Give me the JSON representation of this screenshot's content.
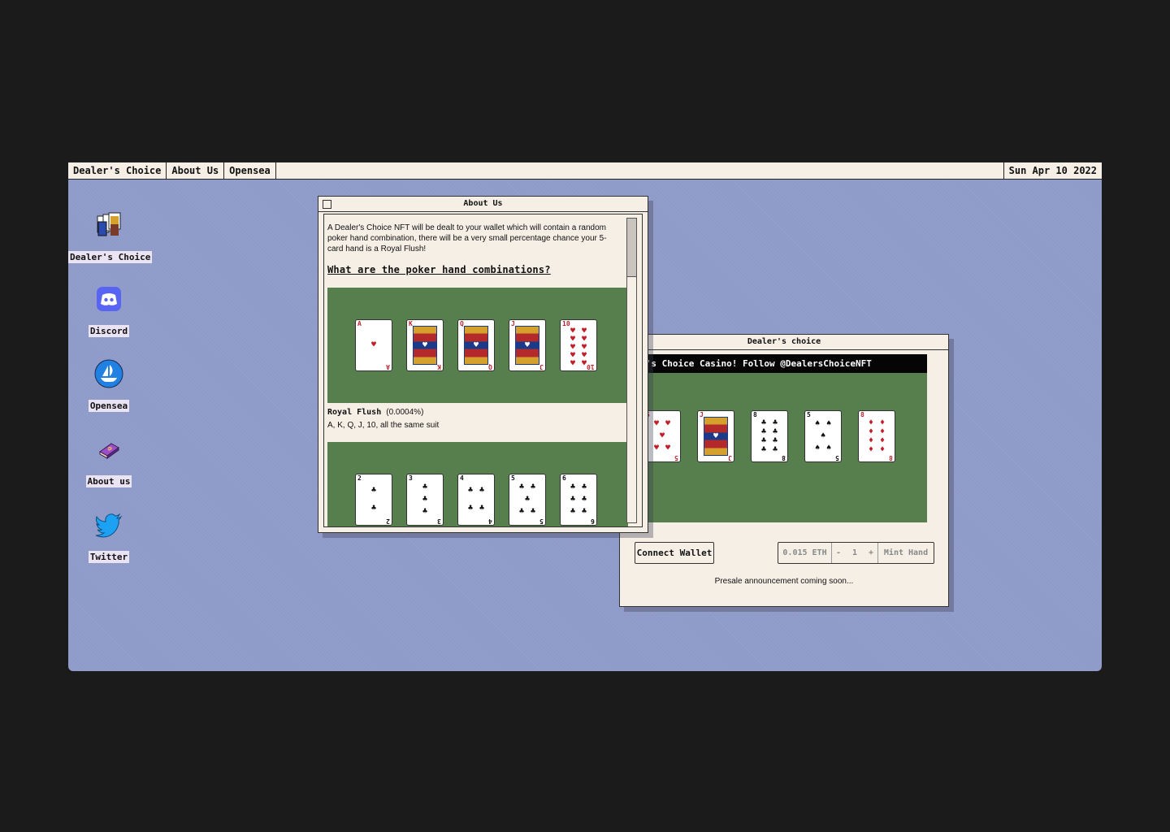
{
  "menubar": {
    "items": [
      "Dealer's Choice",
      "About Us",
      "Opensea"
    ],
    "date": "Sun Apr 10 2022"
  },
  "desktop": {
    "icons": [
      {
        "label": "Dealer's Choice",
        "icon": "playing-cards-icon"
      },
      {
        "label": "Discord",
        "icon": "discord-icon"
      },
      {
        "label": "Opensea",
        "icon": "opensea-icon"
      },
      {
        "label": "About us",
        "icon": "book-icon"
      },
      {
        "label": "Twitter",
        "icon": "twitter-bird-icon"
      }
    ]
  },
  "about_window": {
    "title": "About Us",
    "intro": "A Dealer's Choice NFT will be dealt to your wallet which will contain a random poker hand combination, there will be a very small percentage chance your 5-card hand is a Royal Flush!",
    "heading": "What are the poker hand combinations?",
    "hands": [
      {
        "name": "Royal Flush",
        "odds": "(0.0004%)",
        "desc": "A, K, Q, J, 10, all the same suit",
        "cards": [
          {
            "rank": "A",
            "suit": "♥",
            "color": "red",
            "pips": 1
          },
          {
            "rank": "K",
            "suit": "♥",
            "color": "red",
            "face": true
          },
          {
            "rank": "Q",
            "suit": "♥",
            "color": "red",
            "face": true
          },
          {
            "rank": "J",
            "suit": "♥",
            "color": "red",
            "face": true
          },
          {
            "rank": "10",
            "suit": "♥",
            "color": "red",
            "pips": 10
          }
        ]
      },
      {
        "cards": [
          {
            "rank": "2",
            "suit": "♣",
            "color": "black",
            "pips": 2
          },
          {
            "rank": "3",
            "suit": "♣",
            "color": "black",
            "pips": 3
          },
          {
            "rank": "4",
            "suit": "♣",
            "color": "black",
            "pips": 4
          },
          {
            "rank": "5",
            "suit": "♣",
            "color": "black",
            "pips": 5
          },
          {
            "rank": "6",
            "suit": "♣",
            "color": "black",
            "pips": 6
          }
        ]
      }
    ]
  },
  "dealer_window": {
    "title": "Dealer's choice",
    "ticker": "Dealer's Choice Casino! Follow @DealersChoiceNFT",
    "cards": [
      {
        "rank": "5",
        "suit": "♥",
        "color": "red",
        "pips": 5
      },
      {
        "rank": "J",
        "suit": "♦",
        "color": "red",
        "face": true
      },
      {
        "rank": "8",
        "suit": "♣",
        "color": "black",
        "pips": 8
      },
      {
        "rank": "5",
        "suit": "♠",
        "color": "black",
        "pips": 5
      },
      {
        "rank": "8",
        "suit": "♦",
        "color": "red",
        "pips": 8
      }
    ],
    "connect_label": "Connect Wallet",
    "price": "0.015 ETH",
    "minus": "-",
    "quantity": "1",
    "plus": "+",
    "mint_label": "Mint Hand",
    "presale": "Presale announcement coming soon..."
  },
  "colors": {
    "desktop": "#8e9ac8",
    "felt": "#567f4d",
    "window": "#f6efe6"
  }
}
